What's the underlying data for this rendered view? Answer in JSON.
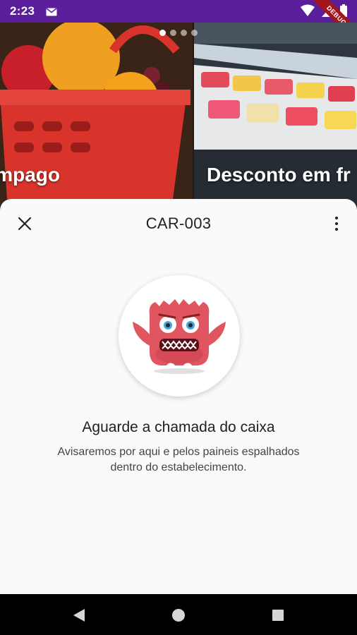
{
  "status_bar": {
    "time": "2:23",
    "debug_label": "DEBUG"
  },
  "carousel": {
    "slides": [
      {
        "title": "mpago"
      },
      {
        "title": "Desconto em fr"
      }
    ],
    "page_count": 4,
    "active_index": 0
  },
  "sheet": {
    "title": "CAR-003",
    "message_title": "Aguarde a chamada do caixa",
    "message_body": "Avisaremos por aqui e pelos paineis espalhados dentro do estabelecimento."
  },
  "icons": {
    "close": "close-icon",
    "more": "more-vertical-icon",
    "back": "back-icon",
    "home": "home-icon",
    "recents": "recents-icon",
    "mascot": "monster-mascot"
  },
  "colors": {
    "status_bar": "#5a1e9a",
    "sheet_bg": "#fafafa",
    "mascot": "#e05560",
    "debug_ribbon": "#a3141d"
  }
}
